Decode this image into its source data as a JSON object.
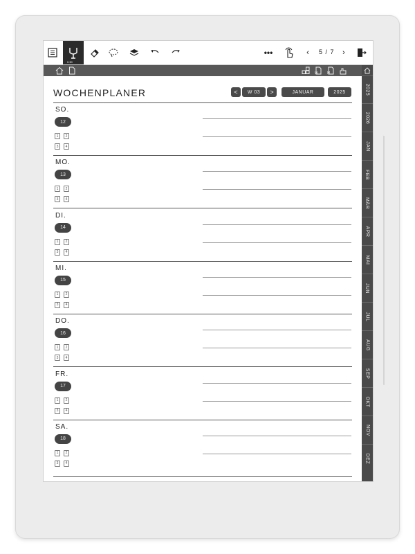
{
  "toolbar": {
    "pen_size_label": "0.30",
    "page_indicator": "5 / 7"
  },
  "planner": {
    "title": "WOCHENPLANER",
    "week_label": "W 03",
    "month_label": "JANUAR",
    "year_label": "2025",
    "prev_symbol": "<",
    "next_symbol": ">"
  },
  "days": [
    {
      "name": "SO.",
      "date": "12",
      "pages": [
        "1",
        "2",
        "3",
        "4"
      ]
    },
    {
      "name": "MO.",
      "date": "13",
      "pages": [
        "1",
        "2",
        "3",
        "4"
      ]
    },
    {
      "name": "DI.",
      "date": "14",
      "pages": [
        "1",
        "2",
        "3",
        "4"
      ]
    },
    {
      "name": "MI.",
      "date": "15",
      "pages": [
        "1",
        "2",
        "3",
        "4"
      ]
    },
    {
      "name": "DO.",
      "date": "16",
      "pages": [
        "1",
        "2",
        "3",
        "4"
      ]
    },
    {
      "name": "FR.",
      "date": "17",
      "pages": [
        "1",
        "2",
        "3",
        "4"
      ]
    },
    {
      "name": "SA.",
      "date": "18",
      "pages": [
        "1",
        "2",
        "3",
        "4"
      ]
    }
  ],
  "sidebar_tabs": [
    "2025",
    "2026",
    "JAN",
    "FEB",
    "MÄR",
    "APR",
    "MAI",
    "JUN",
    "JUL",
    "AUG",
    "SEP",
    "OKT",
    "NOV",
    "DEZ"
  ],
  "icons": {
    "toolbar": [
      "menu-icon",
      "pen-icon",
      "eraser-icon",
      "lasso-icon",
      "layers-icon",
      "undo-icon",
      "redo-icon",
      "more-icon",
      "touch-icon",
      "prev-page-icon",
      "next-page-icon",
      "exit-icon"
    ],
    "subbar": [
      "home-icon",
      "document-icon",
      "grid-icon",
      "note-w-icon",
      "note-m-icon",
      "hand-icon"
    ]
  },
  "colors": {
    "dark": "#4a4a4a",
    "bar": "#585858",
    "device": "#ececec"
  }
}
